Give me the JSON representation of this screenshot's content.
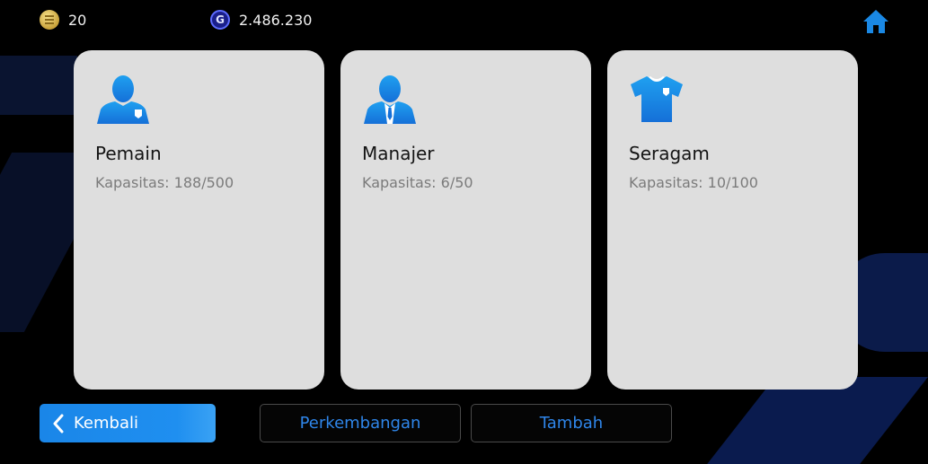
{
  "topbar": {
    "coins": "20",
    "gp": "2.486.230",
    "gp_icon_letter": "G"
  },
  "cards": [
    {
      "title": "Pemain",
      "capacity": "Kapasitas: 188/500",
      "icon": "player-icon"
    },
    {
      "title": "Manajer",
      "capacity": "Kapasitas: 6/50",
      "icon": "manager-icon"
    },
    {
      "title": "Seragam",
      "capacity": "Kapasitas: 10/100",
      "icon": "jersey-icon"
    }
  ],
  "buttons": {
    "back": "Kembali",
    "develop": "Perkembangan",
    "add": "Tambah"
  },
  "colors": {
    "accent": "#1f8ff0",
    "icon_blue": "#1a88e4",
    "card_bg": "#dedede"
  }
}
